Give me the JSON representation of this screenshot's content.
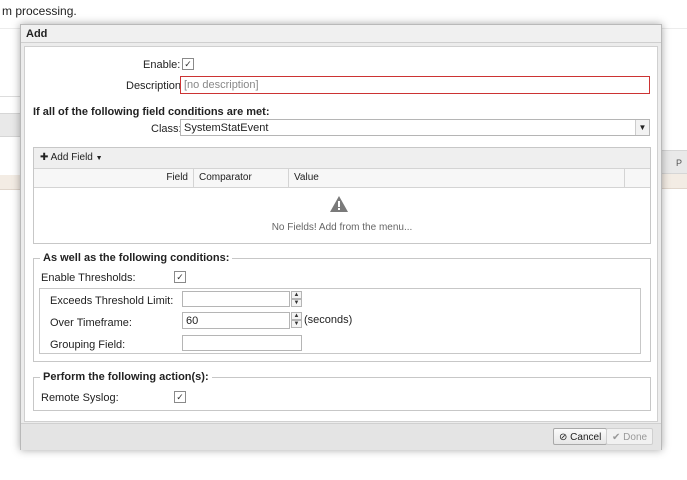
{
  "background": {
    "text": "m processing.",
    "right_col_letter": "P"
  },
  "dialog": {
    "title": "Add",
    "enable_label": "Enable:",
    "enable_checked": true,
    "description_label": "Description:",
    "description_placeholder": "[no description]",
    "conditions_heading": "If all of the following field conditions are met:",
    "class_label": "Class:",
    "class_value": "SystemStatEvent",
    "add_field_label": "Add Field",
    "grid_columns": [
      "Field",
      "Comparator",
      "Value"
    ],
    "no_fields_text": "No Fields! Add from the menu...",
    "thresholds_legend": "As well as the following conditions:",
    "enable_thresholds_label": "Enable Thresholds:",
    "enable_thresholds_checked": true,
    "exceeds_label": "Exceeds Threshold Limit:",
    "exceeds_value": "",
    "timeframe_label": "Over Timeframe:",
    "timeframe_value": "60",
    "timeframe_unit": "(seconds)",
    "grouping_label": "Grouping Field:",
    "grouping_value": "",
    "actions_legend": "Perform the following action(s):",
    "remote_syslog_label": "Remote Syslog:",
    "remote_syslog_checked": true,
    "cancel_label": "Cancel",
    "done_label": "Done"
  },
  "colors": {
    "error_border": "#cc3333",
    "dialog_bg": "#ececec"
  }
}
